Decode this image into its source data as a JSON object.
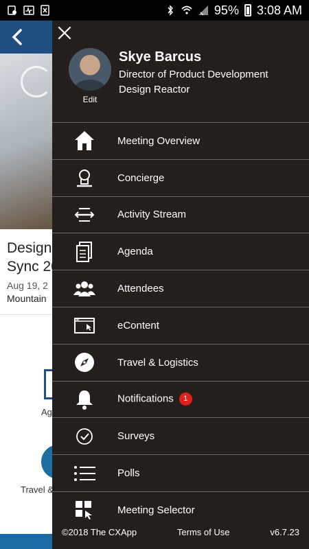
{
  "status": {
    "battery": "95%",
    "time": "3:08 AM"
  },
  "background": {
    "title": "Design\nSync 20",
    "date": "Aug 19, 2",
    "location": "Mountain",
    "tile1_label": "Ag",
    "tile2_label": "Travel &"
  },
  "profile": {
    "name": "Skye Barcus",
    "role": "Director of Product Development",
    "company": "Design Reactor",
    "edit_label": "Edit"
  },
  "menu": {
    "items": [
      {
        "label": "Meeting Overview",
        "icon": "home-icon"
      },
      {
        "label": "Concierge",
        "icon": "concierge-icon"
      },
      {
        "label": "Activity Stream",
        "icon": "activity-stream-icon"
      },
      {
        "label": "Agenda",
        "icon": "agenda-icon"
      },
      {
        "label": "Attendees",
        "icon": "attendees-icon"
      },
      {
        "label": "eContent",
        "icon": "econtent-icon"
      },
      {
        "label": "Travel & Logistics",
        "icon": "compass-icon"
      },
      {
        "label": "Notifications",
        "icon": "bell-icon",
        "badge": "1"
      },
      {
        "label": "Surveys",
        "icon": "check-circle-icon"
      },
      {
        "label": "Polls",
        "icon": "list-icon"
      },
      {
        "label": "Meeting Selector",
        "icon": "meeting-selector-icon"
      }
    ]
  },
  "footer": {
    "copyright": "©2018 The CXApp",
    "terms": "Terms of Use",
    "version": "v6.7.23"
  },
  "colors": {
    "drawer_bg": "#241f1d",
    "header_blue": "#1d4f80",
    "badge_red": "#e0201b"
  }
}
